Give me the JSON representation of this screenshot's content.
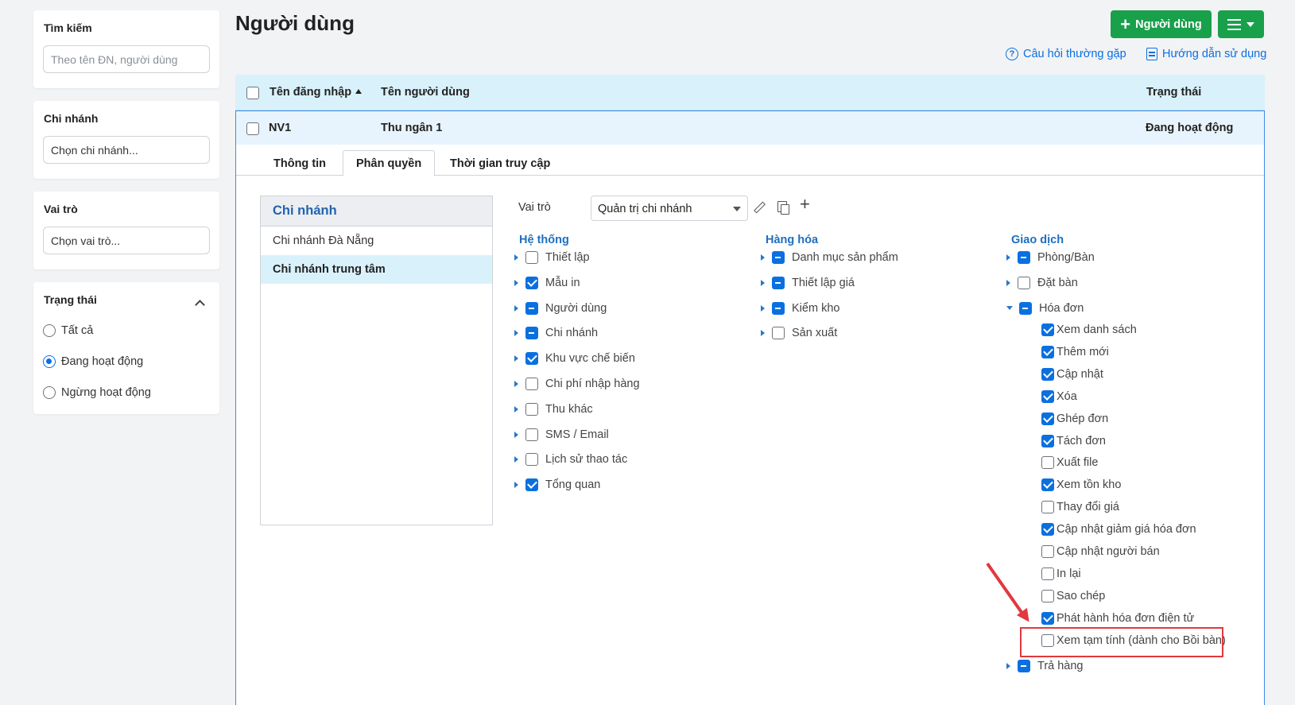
{
  "filters": {
    "search": {
      "title": "Tìm kiếm",
      "placeholder": "Theo tên ĐN, người dùng"
    },
    "branch": {
      "title": "Chi nhánh",
      "placeholder": "Chọn chi nhánh..."
    },
    "role": {
      "title": "Vai trò",
      "placeholder": "Chọn vai trò..."
    },
    "status": {
      "title": "Trạng thái",
      "options": [
        {
          "label": "Tất cả",
          "selected": false
        },
        {
          "label": "Đang hoạt động",
          "selected": true
        },
        {
          "label": "Ngừng hoạt động",
          "selected": false
        }
      ]
    }
  },
  "header": {
    "title": "Người dùng",
    "add_button": "Người dùng",
    "faq_link": "Câu hỏi thường gặp",
    "guide_link": "Hướng dẫn sử dụng"
  },
  "table": {
    "columns": {
      "username": "Tên đăng nhập",
      "fullname": "Tên người dùng",
      "status": "Trạng thái"
    },
    "row": {
      "username": "NV1",
      "fullname": "Thu ngân 1",
      "status": "Đang hoạt động"
    }
  },
  "tabs": [
    {
      "label": "Thông tin"
    },
    {
      "label": "Phân quyền"
    },
    {
      "label": "Thời gian truy cập"
    }
  ],
  "branches": {
    "title": "Chi nhánh",
    "items": [
      "Chi nhánh Đà Nẵng",
      "Chi nhánh trung tâm"
    ]
  },
  "role": {
    "label": "Vai trò",
    "value": "Quản trị chi nhánh"
  },
  "permissions": {
    "system": {
      "title": "Hệ thống",
      "items": [
        {
          "label": "Thiết lập",
          "state": "off"
        },
        {
          "label": "Mẫu in",
          "state": "on"
        },
        {
          "label": "Người dùng",
          "state": "partial"
        },
        {
          "label": "Chi nhánh",
          "state": "partial"
        },
        {
          "label": "Khu vực chế biến",
          "state": "on"
        },
        {
          "label": "Chi phí nhập hàng",
          "state": "off"
        },
        {
          "label": "Thu khác",
          "state": "off"
        },
        {
          "label": "SMS / Email",
          "state": "off"
        },
        {
          "label": "Lịch sử thao tác",
          "state": "off"
        },
        {
          "label": "Tổng quan",
          "state": "on"
        }
      ]
    },
    "goods": {
      "title": "Hàng hóa",
      "items": [
        {
          "label": "Danh mục sản phẩm",
          "state": "partial"
        },
        {
          "label": "Thiết lập giá",
          "state": "partial"
        },
        {
          "label": "Kiểm kho",
          "state": "partial"
        },
        {
          "label": "Sản xuất",
          "state": "off"
        }
      ]
    },
    "transactions": {
      "title": "Giao dịch",
      "items": [
        {
          "label": "Phòng/Bàn",
          "state": "partial"
        },
        {
          "label": "Đặt bàn",
          "state": "off"
        },
        {
          "label": "Hóa đơn",
          "state": "partial"
        }
      ],
      "invoice_sub": [
        {
          "label": "Xem danh sách",
          "state": "on"
        },
        {
          "label": "Thêm mới",
          "state": "on"
        },
        {
          "label": "Cập nhật",
          "state": "on"
        },
        {
          "label": "Xóa",
          "state": "on"
        },
        {
          "label": "Ghép đơn",
          "state": "on"
        },
        {
          "label": "Tách đơn",
          "state": "on"
        },
        {
          "label": "Xuất file",
          "state": "off"
        },
        {
          "label": "Xem tồn kho",
          "state": "on"
        },
        {
          "label": "Thay đổi giá",
          "state": "off"
        },
        {
          "label": "Cập nhật giảm giá hóa đơn",
          "state": "on"
        },
        {
          "label": "Cập nhật người bán",
          "state": "off"
        },
        {
          "label": "In lại",
          "state": "off"
        },
        {
          "label": "Sao chép",
          "state": "off"
        },
        {
          "label": "Phát hành hóa đơn điện tử",
          "state": "on"
        },
        {
          "label": "Xem tạm tính (dành cho Bồi bàn)",
          "state": "off"
        }
      ],
      "return_item": {
        "label": "Trả hàng",
        "state": "partial"
      }
    }
  },
  "colors": {
    "accent_green": "#19a04b",
    "link_blue": "#0a70e0",
    "header_bg": "#d9f1fb",
    "highlight_red": "#e0393e"
  }
}
